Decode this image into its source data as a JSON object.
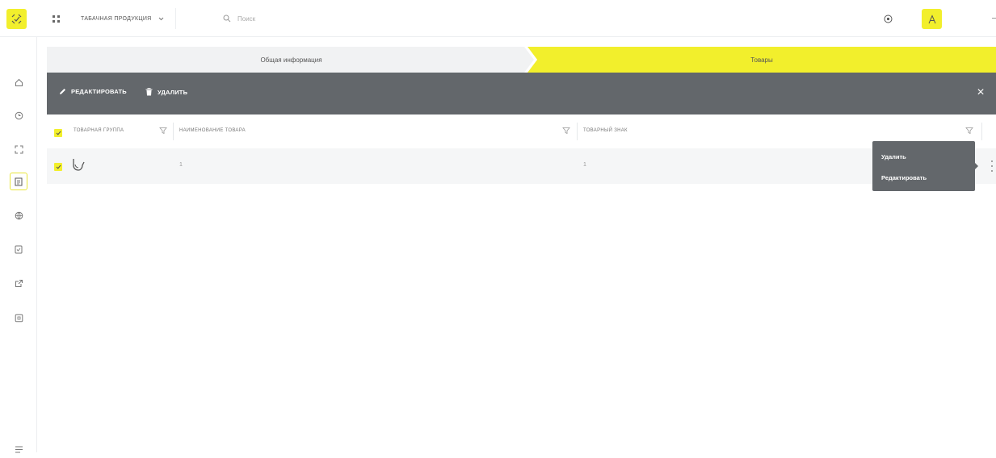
{
  "header": {
    "product_group": "ТАБАЧНАЯ ПРОДУКЦИЯ",
    "search_placeholder": "Поиск"
  },
  "steps": [
    {
      "label": "Общая информация"
    },
    {
      "label": "Товары"
    }
  ],
  "actions": {
    "edit_label": "РЕДАКТИРОВАТЬ",
    "delete_label": "УДАЛИТЬ"
  },
  "table": {
    "columns": [
      "ТОВАРНАЯ ГРУППА",
      "НАИМЕНОВАНИЕ ТОВАРА",
      "ТОВАРНЫЙ ЗНАК"
    ],
    "rows": [
      {
        "group_icon": "tobacco-pipe-icon",
        "name": "1",
        "brand": "1"
      }
    ]
  },
  "context_menu": {
    "items": [
      "Удалить",
      "Редактировать"
    ]
  },
  "colors": {
    "accent": "#f2ef2c",
    "action_bar": "#63676b"
  }
}
